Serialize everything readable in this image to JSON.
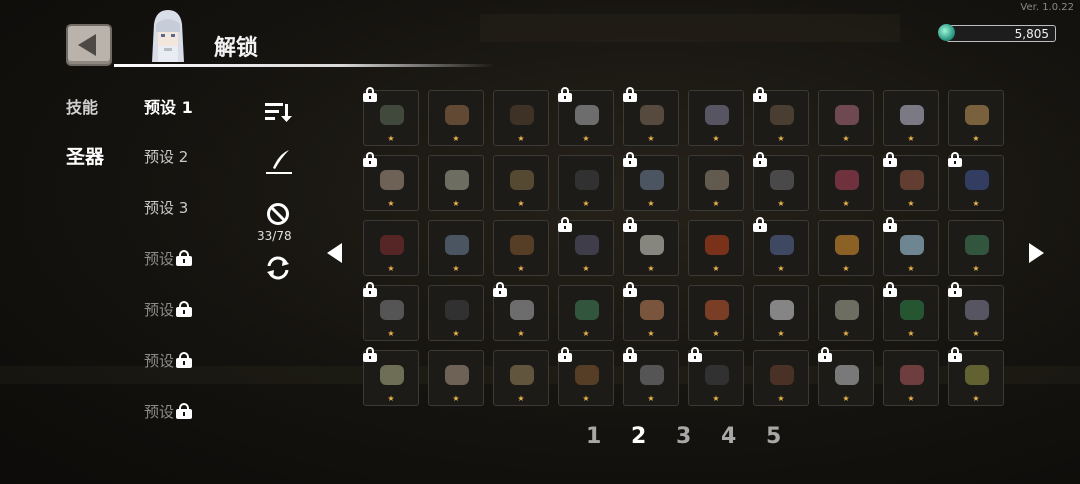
{
  "version": "Ver. 1.0.22",
  "header": {
    "title": "解锁"
  },
  "currency": {
    "amount": "5,805",
    "icon": "gem-icon",
    "color": "#3fbfa0"
  },
  "categories": [
    {
      "label": "技能",
      "active": false
    },
    {
      "label": "圣器",
      "active": true
    }
  ],
  "presets": [
    {
      "label": "预设 1",
      "active": true,
      "locked": false
    },
    {
      "label": "预设 2",
      "active": false,
      "locked": false
    },
    {
      "label": "预设 3",
      "active": false,
      "locked": false
    },
    {
      "label": "预设",
      "active": false,
      "locked": true
    },
    {
      "label": "预设",
      "active": false,
      "locked": true
    },
    {
      "label": "预设",
      "active": false,
      "locked": true
    },
    {
      "label": "预设",
      "active": false,
      "locked": true
    }
  ],
  "tools": {
    "counter": "33/78"
  },
  "grid": {
    "rows": [
      [
        {
          "locked": true,
          "color": "#4d5a48"
        },
        {
          "locked": false,
          "color": "#7a5a3c"
        },
        {
          "locked": false,
          "color": "#4a3a2a"
        },
        {
          "locked": true,
          "color": "#8a8a8a"
        },
        {
          "locked": true,
          "color": "#6a5a4a"
        },
        {
          "locked": false,
          "color": "#6a6a7a"
        },
        {
          "locked": true,
          "color": "#5a4a3a"
        },
        {
          "locked": false,
          "color": "#8a5a66"
        },
        {
          "locked": false,
          "color": "#9a9aa8"
        },
        {
          "locked": false,
          "color": "#9a7a4a"
        }
      ],
      [
        {
          "locked": true,
          "color": "#8a7a6a"
        },
        {
          "locked": false,
          "color": "#8a8a7a"
        },
        {
          "locked": false,
          "color": "#6a5a3a"
        },
        {
          "locked": false,
          "color": "#3a3a3a"
        },
        {
          "locked": true,
          "color": "#5a6a7a"
        },
        {
          "locked": false,
          "color": "#7a7060"
        },
        {
          "locked": true,
          "color": "#5a5a5a"
        },
        {
          "locked": false,
          "color": "#8a3a4a"
        },
        {
          "locked": true,
          "color": "#7a4a3a"
        },
        {
          "locked": true,
          "color": "#3a4a7a"
        }
      ],
      [
        {
          "locked": false,
          "color": "#6a2a2a"
        },
        {
          "locked": false,
          "color": "#5a6a7a"
        },
        {
          "locked": false,
          "color": "#6a4a2a"
        },
        {
          "locked": true,
          "color": "#4a4a5a"
        },
        {
          "locked": true,
          "color": "#aaaaa0"
        },
        {
          "locked": false,
          "color": "#9a3a1a"
        },
        {
          "locked": true,
          "color": "#4a5a7a"
        },
        {
          "locked": false,
          "color": "#b07a2a"
        },
        {
          "locked": true,
          "color": "#8aaabb"
        },
        {
          "locked": false,
          "color": "#3a6a4a"
        }
      ],
      [
        {
          "locked": true,
          "color": "#6a6a6a"
        },
        {
          "locked": false,
          "color": "#3a3a3a"
        },
        {
          "locked": true,
          "color": "#8a8a8a"
        },
        {
          "locked": false,
          "color": "#3a6a4a"
        },
        {
          "locked": true,
          "color": "#9a6a4a"
        },
        {
          "locked": false,
          "color": "#9a4a2a"
        },
        {
          "locked": false,
          "color": "#aaaaaa"
        },
        {
          "locked": false,
          "color": "#8a8a7a"
        },
        {
          "locked": true,
          "color": "#2a6a3a"
        },
        {
          "locked": true,
          "color": "#6a6a7a"
        }
      ],
      [
        {
          "locked": true,
          "color": "#8a8a6a"
        },
        {
          "locked": false,
          "color": "#8a7a6a"
        },
        {
          "locked": false,
          "color": "#7a6a4a"
        },
        {
          "locked": true,
          "color": "#6a4a2a"
        },
        {
          "locked": true,
          "color": "#6a6a6a"
        },
        {
          "locked": true,
          "color": "#3a3a3a"
        },
        {
          "locked": false,
          "color": "#5a3a2a"
        },
        {
          "locked": true,
          "color": "#9a9a9a"
        },
        {
          "locked": false,
          "color": "#8a4a4a"
        },
        {
          "locked": true,
          "color": "#7a7a3a"
        }
      ]
    ]
  },
  "pagination": {
    "pages": [
      "1",
      "2",
      "3",
      "4",
      "5"
    ],
    "current": "2"
  }
}
